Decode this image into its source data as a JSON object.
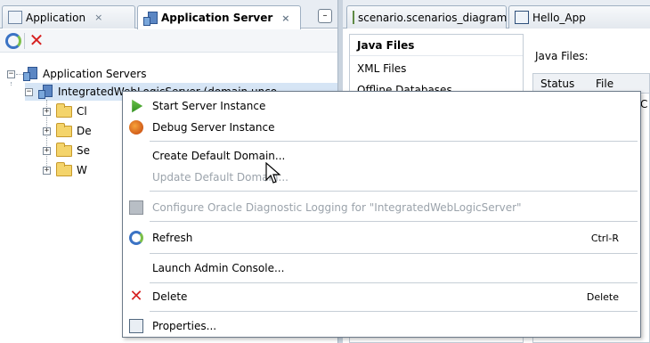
{
  "left_panel": {
    "tabs": [
      {
        "label": "Application",
        "close": "×"
      },
      {
        "label": "Application Server",
        "close": "×"
      }
    ],
    "minimize_symbol": "–",
    "tree": {
      "root_label": "Application Servers",
      "root_expander": "−",
      "server_label": "IntegratedWebLogicServer (domain unco",
      "server_expander": "−",
      "children": [
        "Cl",
        "De",
        "Se",
        "W"
      ],
      "child_expander": "+"
    }
  },
  "right_panel": {
    "tabs": [
      {
        "label": "scenario.scenarios_diagram",
        "close": "×"
      },
      {
        "label": "Hello_App"
      }
    ],
    "file_categories": [
      "Java Files",
      "XML Files",
      "Offline Databases"
    ],
    "java_files_label": "Java Files:",
    "table_headers": [
      "Status",
      "File"
    ],
    "partial_cell": "C"
  },
  "context_menu": {
    "items": [
      {
        "label": "Start Server Instance",
        "icon": "play-icon",
        "accel": "",
        "disabled": false
      },
      {
        "label": "Debug Server Instance",
        "icon": "bug-icon",
        "accel": "",
        "disabled": false
      },
      {
        "label": "Create Default Domain...",
        "icon": "",
        "accel": "",
        "disabled": false
      },
      {
        "label": "Update Default Domain...",
        "icon": "",
        "accel": "",
        "disabled": true
      },
      {
        "label": "Configure Oracle Diagnostic Logging for \"IntegratedWebLogicServer\"",
        "icon": "oracle-icon",
        "accel": "",
        "disabled": true
      },
      {
        "label": "Refresh",
        "icon": "refresh-icon",
        "accel": "Ctrl-R",
        "disabled": false
      },
      {
        "label": "Launch Admin Console...",
        "icon": "",
        "accel": "",
        "disabled": false
      },
      {
        "label": "Delete",
        "icon": "delete-icon",
        "accel": "Delete",
        "disabled": false
      },
      {
        "label": "Properties...",
        "icon": "properties-icon",
        "accel": "",
        "disabled": false
      }
    ]
  },
  "colors": {
    "tab_bar": "#e8edf3",
    "selection": "#d6e5f5",
    "disabled_text": "#9ba3ab",
    "delete_red": "#d62020"
  }
}
